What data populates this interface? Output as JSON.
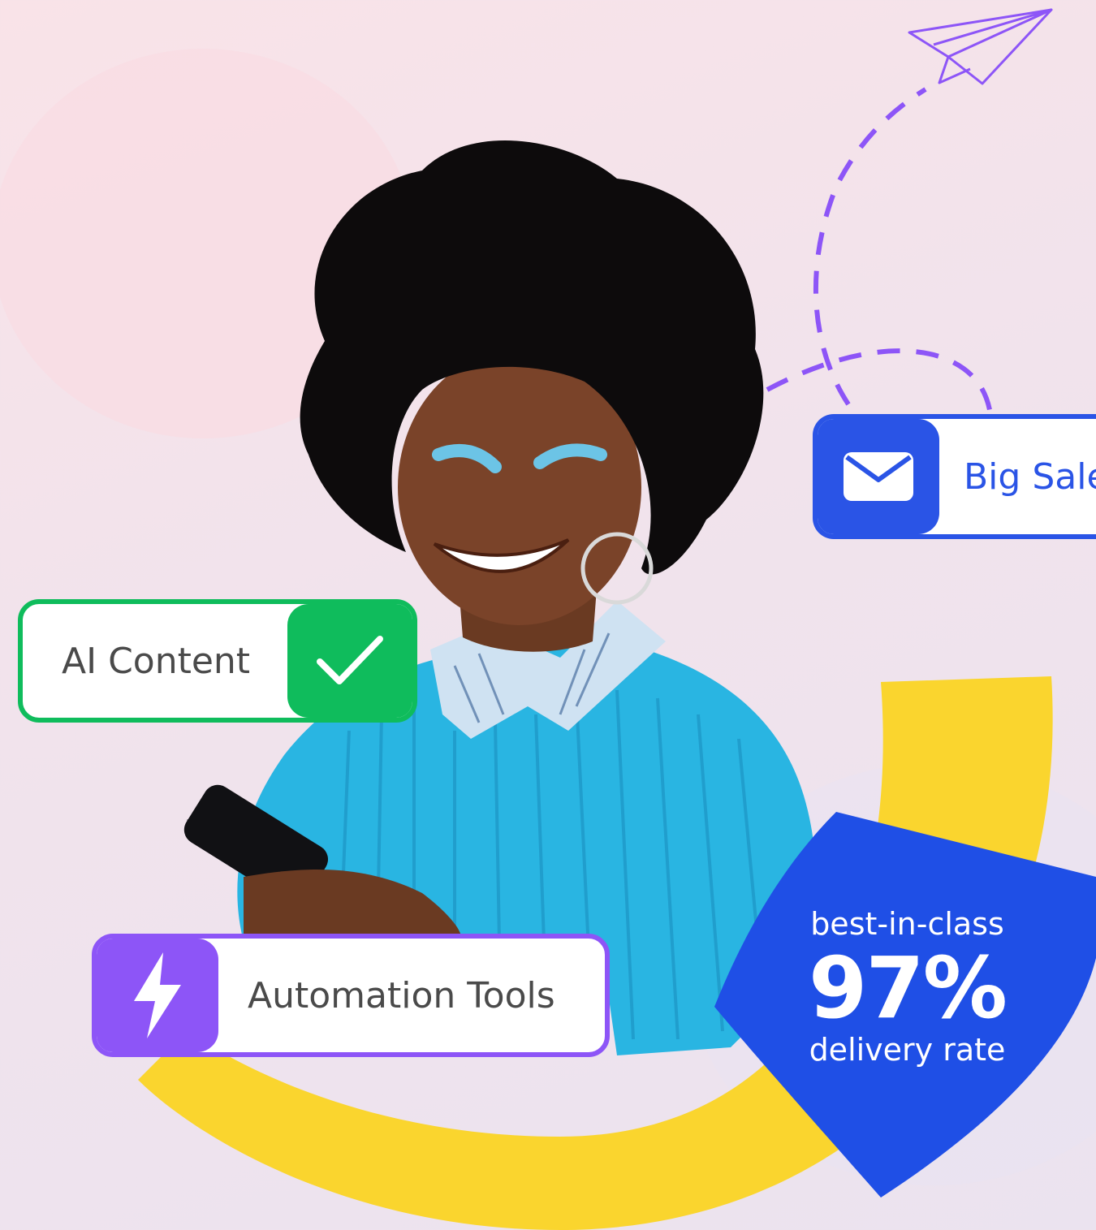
{
  "badges": {
    "ai_content": {
      "label": "AI Content",
      "icon": "check-icon",
      "color": "#0fbc5c"
    },
    "automation": {
      "label": "Automation Tools",
      "icon": "lightning-icon",
      "color": "#8d55f7"
    },
    "email": {
      "label": "Big Sale",
      "icon": "envelope-icon",
      "color": "#2a54e6"
    }
  },
  "stat": {
    "line1": "best-in-class",
    "value": "97%",
    "line3": "delivery rate",
    "shield_color": "#1f4fe6"
  },
  "decor": {
    "arc_color": "#fad52e",
    "dash_color": "#8d55f7",
    "plane_icon": "paper-plane-icon"
  }
}
